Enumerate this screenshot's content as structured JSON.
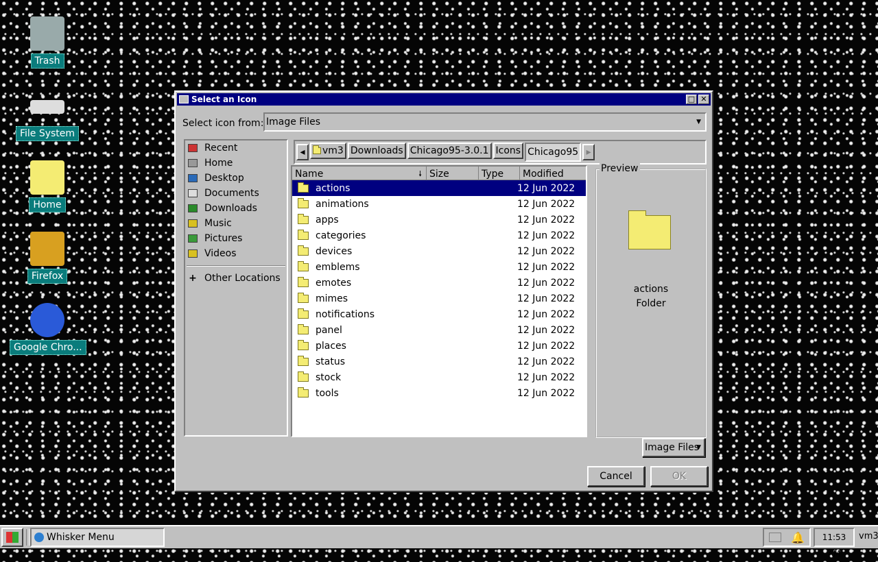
{
  "desktop": {
    "icons": [
      {
        "label": "Trash",
        "icon": "trash-icon"
      },
      {
        "label": "File System",
        "icon": "drive-icon"
      },
      {
        "label": "Home",
        "icon": "home-folder-icon"
      },
      {
        "label": "Firefox",
        "icon": "firefox-icon"
      },
      {
        "label": "Google Chro...",
        "icon": "chrome-icon"
      }
    ]
  },
  "dialog": {
    "title": "Select an Icon",
    "source_label": "Select icon from:",
    "source_value": "Image Files",
    "places": [
      {
        "label": "Recent",
        "icon": "recent-icon"
      },
      {
        "label": "Home",
        "icon": "home-icon"
      },
      {
        "label": "Desktop",
        "icon": "desktop-icon"
      },
      {
        "label": "Documents",
        "icon": "documents-icon"
      },
      {
        "label": "Downloads",
        "icon": "downloads-icon"
      },
      {
        "label": "Music",
        "icon": "music-icon"
      },
      {
        "label": "Pictures",
        "icon": "pictures-icon"
      },
      {
        "label": "Videos",
        "icon": "videos-icon"
      }
    ],
    "other_locations": "Other Locations",
    "path": [
      "vm3",
      "Downloads",
      "Chicago95-3.0.1",
      "Icons",
      "Chicago95"
    ],
    "columns": {
      "name": "Name",
      "size": "Size",
      "type": "Type",
      "modified": "Modified"
    },
    "files": [
      {
        "name": "actions",
        "modified": "12 Jun 2022",
        "selected": true
      },
      {
        "name": "animations",
        "modified": "12 Jun 2022"
      },
      {
        "name": "apps",
        "modified": "12 Jun 2022"
      },
      {
        "name": "categories",
        "modified": "12 Jun 2022"
      },
      {
        "name": "devices",
        "modified": "12 Jun 2022"
      },
      {
        "name": "emblems",
        "modified": "12 Jun 2022"
      },
      {
        "name": "emotes",
        "modified": "12 Jun 2022"
      },
      {
        "name": "mimes",
        "modified": "12 Jun 2022"
      },
      {
        "name": "notifications",
        "modified": "12 Jun 2022"
      },
      {
        "name": "panel",
        "modified": "12 Jun 2022"
      },
      {
        "name": "places",
        "modified": "12 Jun 2022"
      },
      {
        "name": "status",
        "modified": "12 Jun 2022"
      },
      {
        "name": "stock",
        "modified": "12 Jun 2022"
      },
      {
        "name": "tools",
        "modified": "12 Jun 2022"
      }
    ],
    "preview": {
      "label": "Preview",
      "name": "actions",
      "kind": "Folder"
    },
    "filter_value": "Image Files",
    "cancel_label": "Cancel",
    "ok_label": "OK"
  },
  "taskbar": {
    "task_label": "Whisker Menu",
    "clock": "11:53 AM",
    "user": "vm3"
  }
}
